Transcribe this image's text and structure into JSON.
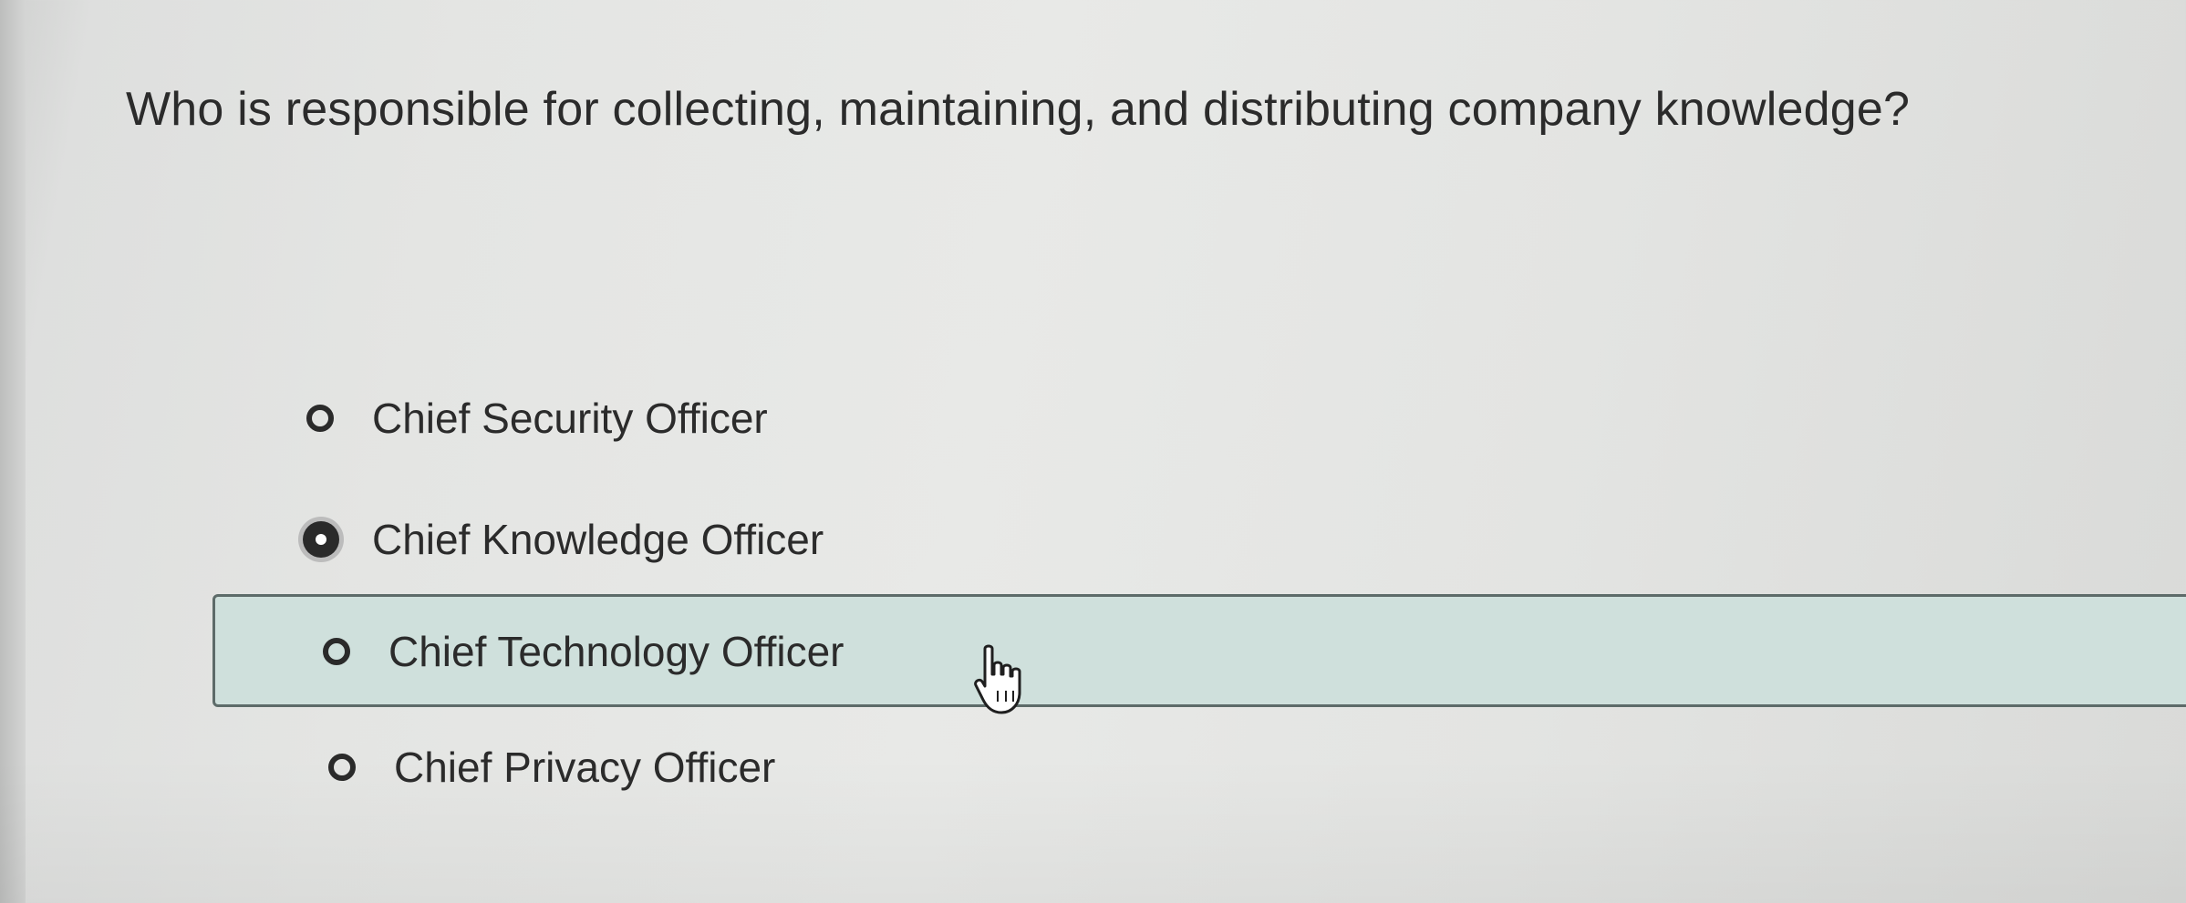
{
  "question": {
    "text": "Who is responsible for collecting, maintaining, and distributing company knowledge?"
  },
  "options": [
    {
      "label": "Chief Security Officer",
      "selected": false,
      "hovered": false
    },
    {
      "label": "Chief Knowledge Officer",
      "selected": true,
      "hovered": false
    },
    {
      "label": "Chief Technology Officer",
      "selected": false,
      "hovered": true
    },
    {
      "label": "Chief Privacy Officer",
      "selected": false,
      "hovered": false
    }
  ],
  "colors": {
    "background": "#e4e5e3",
    "text": "#2b2b2b",
    "hover_fill": "#cfe0dc",
    "hover_border": "#5d6b69",
    "radio": "#2a2a2a"
  },
  "icons": {
    "cursor": "hand-pointer-icon"
  }
}
